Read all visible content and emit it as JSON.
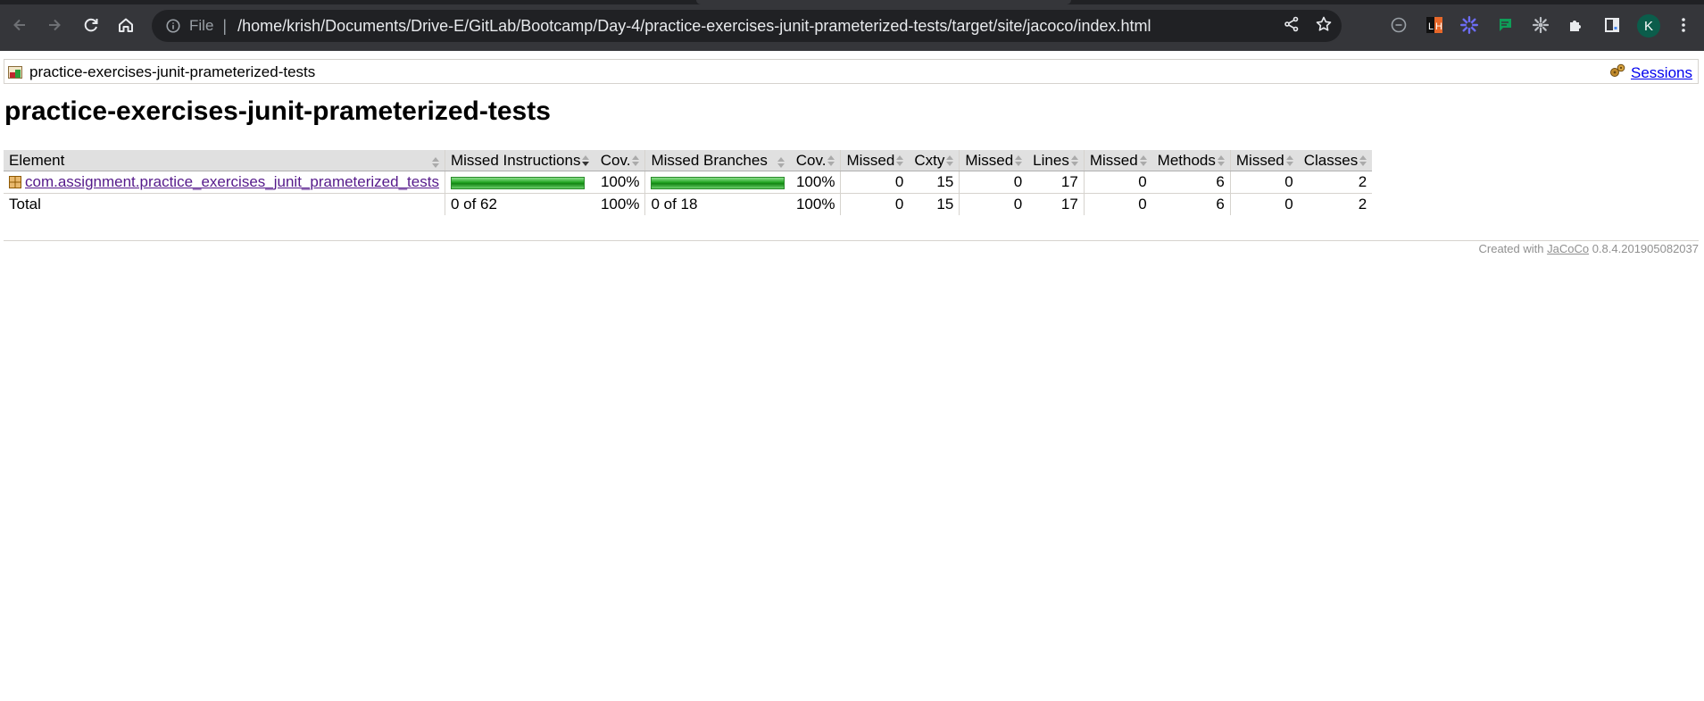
{
  "browser": {
    "omnibox": {
      "scheme_label": "File",
      "url": "/home/krish/Documents/Drive-E/GitLab/Bootcamp/Day-4/practice-exercises-junit-prameterized-tests/target/site/jacoco/index.html"
    },
    "profile_initial": "K",
    "extensions": [
      "circle-dash-icon",
      "lighthouse-icon",
      "asterisk-extension-icon",
      "chat-extension-icon",
      "gear-extension-icon",
      "puzzle-icon",
      "sidebar-icon"
    ]
  },
  "breadcrumb": {
    "current": "practice-exercises-junit-prameterized-tests",
    "sessions_link": "Sessions"
  },
  "page": {
    "title": "practice-exercises-junit-prameterized-tests"
  },
  "table": {
    "headers": [
      "Element",
      "Missed Instructions",
      "Cov.",
      "Missed Branches",
      "Cov.",
      "Missed",
      "Cxty",
      "Missed",
      "Lines",
      "Missed",
      "Methods",
      "Missed",
      "Classes"
    ],
    "rows": [
      {
        "element": "com.assignment.practice_exercises_junit_prameterized_tests",
        "instr_cov": "100%",
        "instr_fraction": 1.0,
        "branch_cov": "100%",
        "branch_fraction": 1.0,
        "missed_cxty": "0",
        "cxty": "15",
        "missed_lines": "0",
        "lines": "17",
        "missed_methods": "0",
        "methods": "6",
        "missed_classes": "0",
        "classes": "2"
      }
    ],
    "total": {
      "label": "Total",
      "instr": "0 of 62",
      "instr_cov": "100%",
      "branch": "0 of 18",
      "branch_cov": "100%",
      "missed_cxty": "0",
      "cxty": "15",
      "missed_lines": "0",
      "lines": "17",
      "missed_methods": "0",
      "methods": "6",
      "missed_classes": "0",
      "classes": "2"
    }
  },
  "footer": {
    "prefix": "Created with",
    "link": "JaCoCo",
    "version": "0.8.4.201905082037"
  },
  "colors": {
    "toolbar": "#35363a",
    "coverage_bar": "#1fa31f",
    "link": "#0000ee",
    "visited_link": "#551a8b"
  }
}
